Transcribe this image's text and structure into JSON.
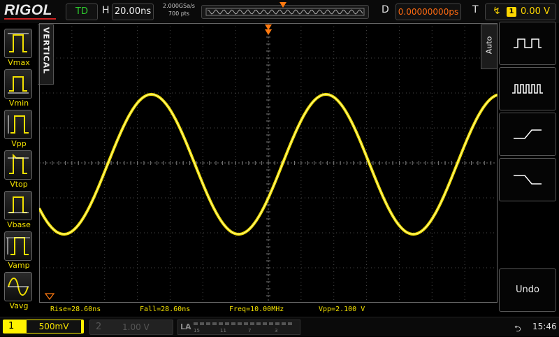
{
  "header": {
    "brand": "RIGOL",
    "run_status": "TD",
    "horizontal_label": "H",
    "time_scale": "20.00ns",
    "sample_rate": "2.000GSa/s",
    "memory_depth": "700 pts",
    "delay_label": "D",
    "delay_value": "0.00000000ps",
    "trigger_label": "T",
    "trigger_source": "1",
    "trigger_level": "0.00 V"
  },
  "left_panel": {
    "tab_label": "VERTICAL",
    "measure_buttons": [
      {
        "label": "Vmax",
        "icon": "vmax-pulse-icon"
      },
      {
        "label": "Vmin",
        "icon": "vmin-pulse-icon"
      },
      {
        "label": "Vpp",
        "icon": "vpp-pulse-icon"
      },
      {
        "label": "Vtop",
        "icon": "vtop-pulse-icon"
      },
      {
        "label": "Vbase",
        "icon": "vbase-pulse-icon"
      },
      {
        "label": "Vamp",
        "icon": "vamp-pulse-icon"
      },
      {
        "label": "Vavg",
        "icon": "vavg-sine-icon"
      }
    ]
  },
  "right_panel": {
    "tab_label": "Auto",
    "buttons": [
      {
        "icon": "single-period-icon"
      },
      {
        "icon": "multi-period-icon"
      },
      {
        "icon": "rising-edge-icon"
      },
      {
        "icon": "falling-edge-icon"
      }
    ],
    "undo_label": "Undo"
  },
  "measurements": {
    "rise": "Rise=28.60ns",
    "fall": "Fall=28.60ns",
    "freq": "Freq=10.00MHz",
    "vpp": "Vpp=2.100 V"
  },
  "footer": {
    "ch1_number": "1",
    "ch1_scale": "500mV",
    "ch2_number": "2",
    "ch2_scale": "1.00 V",
    "la_label": "LA",
    "la_channels": [
      "15",
      "11",
      "7",
      "3"
    ],
    "time": "15:46"
  },
  "colors": {
    "ch1": "#f2e000",
    "trigger": "#ff7a10",
    "status": "#2ecc2e",
    "grid": "#4a4a4a"
  },
  "trace": {
    "channel": "1",
    "waveform": "sine",
    "frequency": "10.00MHz",
    "vpp": "2.100 V"
  }
}
